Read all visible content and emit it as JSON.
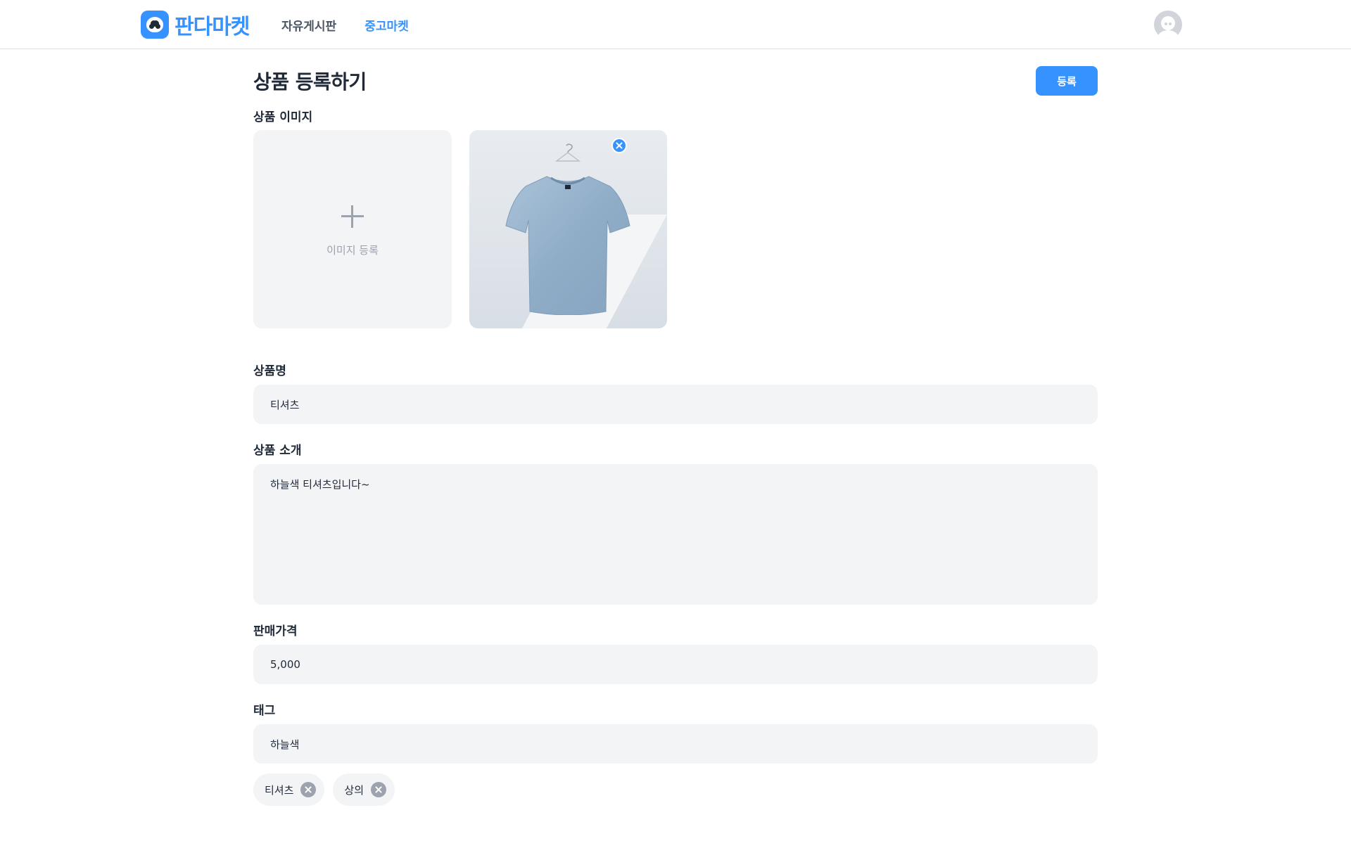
{
  "header": {
    "logo_text": "판다마켓",
    "nav": [
      {
        "label": "자유게시판",
        "active": false
      },
      {
        "label": "중고마켓",
        "active": true
      }
    ],
    "avatar_icon": "user-avatar-icon"
  },
  "page": {
    "title": "상품 등록하기",
    "submit_label": "등록"
  },
  "images": {
    "label": "상품 이미지",
    "upload_text": "이미지 등록",
    "preview_icon": "tshirt-photo"
  },
  "name": {
    "label": "상품명",
    "value": "티셔츠"
  },
  "description": {
    "label": "상품 소개",
    "value": "하늘색 티셔츠입니다~"
  },
  "price": {
    "label": "판매가격",
    "value": "5,000"
  },
  "tag_field": {
    "label": "태그",
    "value": "하늘색"
  },
  "tags": [
    "티셔츠",
    "상의"
  ],
  "colors": {
    "accent": "#3692ff",
    "input_bg": "#f3f4f6",
    "muted": "#9ca3af"
  }
}
